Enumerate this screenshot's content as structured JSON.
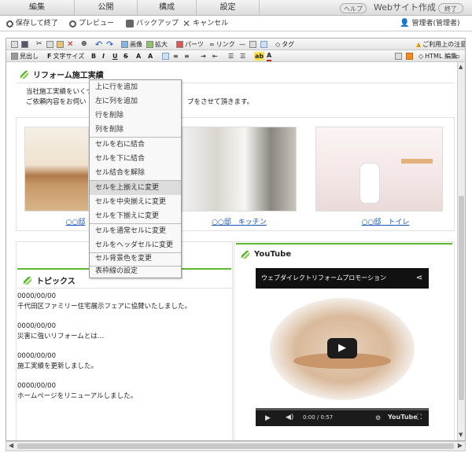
{
  "top_menu": {
    "items": [
      "編集",
      "公開",
      "構成",
      "設定"
    ],
    "help": "ヘルプ",
    "site": "Webサイト作成",
    "exit": "終了"
  },
  "actions": {
    "save_exit": "保存して終了",
    "preview": "プレビュー",
    "backup": "バックアップ",
    "cancel": "キャンセル",
    "user": "管理者(管理者)"
  },
  "toolbar1": {
    "image": "画像",
    "enlarge": "拡大",
    "parts": "パーツ",
    "link": "リンク",
    "tag": "タグ",
    "notice": "ご利用上の注意"
  },
  "toolbar2": {
    "heading": "見出し",
    "font_size": "文字サイズ",
    "bold": "B",
    "italic": "I",
    "underline": "U",
    "html_edit": "HTML 編集"
  },
  "section1": {
    "title": "リフォーム施工実績",
    "line1": "当社施工実績をいくつ",
    "line2": "ご依頼内容をお伺い",
    "line2_tail": "ブをさせて頂きます。"
  },
  "captions": [
    "○○邸",
    "○○邸　キッチン",
    "○○邸　トイレ"
  ],
  "context_menu": {
    "items": [
      "上に行を追加",
      "左に列を追加",
      "行を削除",
      "列を削除",
      "セルを右に結合",
      "セルを下に結合",
      "セル結合を解除",
      "セルを上揃えに変更",
      "セルを中央揃えに変更",
      "セルを下揃えに変更",
      "セルを通常セルに変更",
      "セルをヘッダセルに変更",
      "セル背景色を変更",
      "表枠線の設定"
    ],
    "highlighted_index": 7
  },
  "topics": {
    "title": "トピックス",
    "entries": [
      {
        "date": "0000/00/00",
        "text": "千代田区ファミリー住宅展示フェアに協賛いたしました。"
      },
      {
        "date": "0000/00/00",
        "text": "災害に強いリフォームとは…"
      },
      {
        "date": "0000/00/00",
        "text": "施工実績を更新しました。"
      },
      {
        "date": "0000/00/00",
        "text": "ホームページをリニューアルしました。"
      }
    ]
  },
  "youtube": {
    "title": "YouTube",
    "video_title": "ウェブダイレクトリフォームプロモーション",
    "time": "0:00 / 0:57",
    "logo": "YouTube"
  },
  "colors": {
    "accent_green": "#5cb82e"
  }
}
